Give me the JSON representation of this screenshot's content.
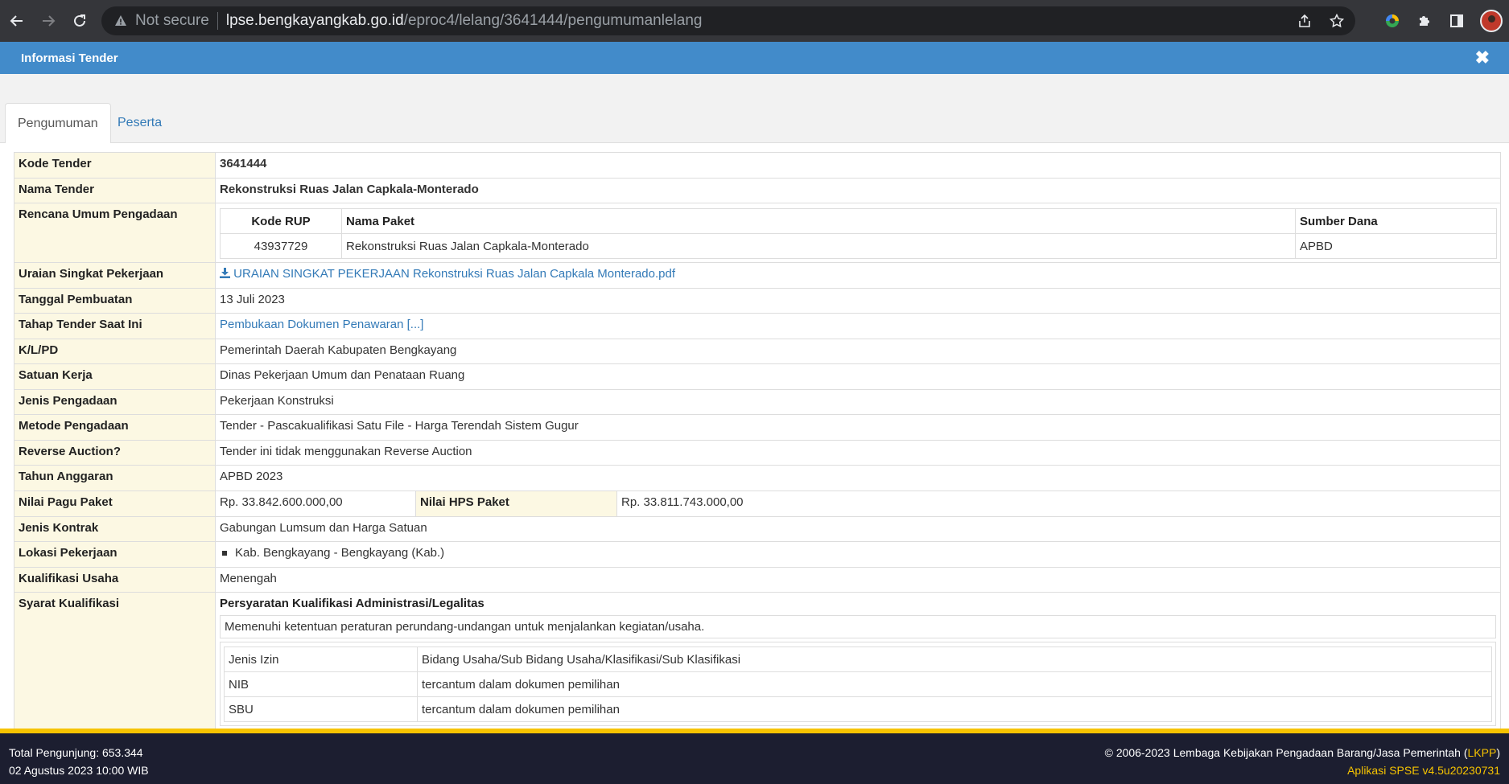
{
  "browser": {
    "security_label": "Not secure",
    "url_host": "lpse.bengkayangkab.go.id",
    "url_path": "/eproc4/lelang/3641444/pengumumanlelang"
  },
  "modal": {
    "title": "Informasi Tender",
    "close": "✖"
  },
  "tabs": [
    {
      "label": "Pengumuman"
    },
    {
      "label": "Peserta"
    }
  ],
  "info": {
    "kode_tender": {
      "label": "Kode Tender",
      "value": "3641444"
    },
    "nama_tender": {
      "label": "Nama Tender",
      "value": "Rekonstruksi Ruas Jalan Capkala-Monterado"
    },
    "rup": {
      "label": "Rencana Umum Pengadaan",
      "headers": [
        "Kode RUP",
        "Nama Paket",
        "Sumber Dana"
      ],
      "row": [
        "43937729",
        "Rekonstruksi Ruas Jalan Capkala-Monterado",
        "APBD"
      ]
    },
    "uraian": {
      "label": "Uraian Singkat Pekerjaan",
      "value": "URAIAN SINGKAT PEKERJAAN Rekonstruksi Ruas Jalan Capkala Monterado.pdf"
    },
    "tanggal": {
      "label": "Tanggal Pembuatan",
      "value": "13 Juli 2023"
    },
    "tahap": {
      "label": "Tahap Tender Saat Ini",
      "value": "Pembukaan Dokumen Penawaran [...]"
    },
    "klpd": {
      "label": "K/L/PD",
      "value": "Pemerintah Daerah Kabupaten Bengkayang"
    },
    "satker": {
      "label": "Satuan Kerja",
      "value": "Dinas Pekerjaan Umum dan Penataan Ruang"
    },
    "jenis_pengadaan": {
      "label": "Jenis Pengadaan",
      "value": "Pekerjaan Konstruksi"
    },
    "metode": {
      "label": "Metode Pengadaan",
      "value": "Tender - Pascakualifikasi Satu File - Harga Terendah Sistem Gugur"
    },
    "reverse": {
      "label": "Reverse Auction?",
      "value": "Tender ini tidak menggunakan Reverse Auction"
    },
    "tahun": {
      "label": "Tahun Anggaran",
      "value": "APBD 2023"
    },
    "pagu": {
      "label": "Nilai Pagu Paket",
      "value": "Rp. 33.842.600.000,00",
      "hps_label": "Nilai HPS Paket",
      "hps_value": "Rp. 33.811.743.000,00"
    },
    "kontrak": {
      "label": "Jenis Kontrak",
      "value": "Gabungan Lumsum dan Harga Satuan"
    },
    "lokasi": {
      "label": "Lokasi Pekerjaan",
      "value": "Kab. Bengkayang - Bengkayang (Kab.)"
    },
    "kualifikasi_usaha": {
      "label": "Kualifikasi Usaha",
      "value": "Menengah"
    },
    "syarat": {
      "label": "Syarat Kualifikasi",
      "heading": "Persyaratan Kualifikasi Administrasi/Legalitas",
      "text": "Memenuhi ketentuan peraturan perundang-undangan untuk menjalankan kegiatan/usaha.",
      "izin_rows": [
        [
          "Jenis Izin",
          "Bidang Usaha/Sub Bidang Usaha/Klasifikasi/Sub Klasifikasi"
        ],
        [
          "NIB",
          "tercantum dalam dokumen pemilihan"
        ],
        [
          "SBU",
          "tercantum dalam dokumen pemilihan"
        ]
      ]
    }
  },
  "footer": {
    "visitors": "Total Pengunjung: 653.344",
    "datetime": "02 Agustus 2023 10:00 WIB",
    "copyright_prefix": "© 2006-2023 Lembaga Kebijakan Pengadaan Barang/Jasa Pemerintah (",
    "copyright_link": "LKPP",
    "copyright_suffix": ")",
    "app_version": "Aplikasi SPSE v4.5u20230731"
  }
}
